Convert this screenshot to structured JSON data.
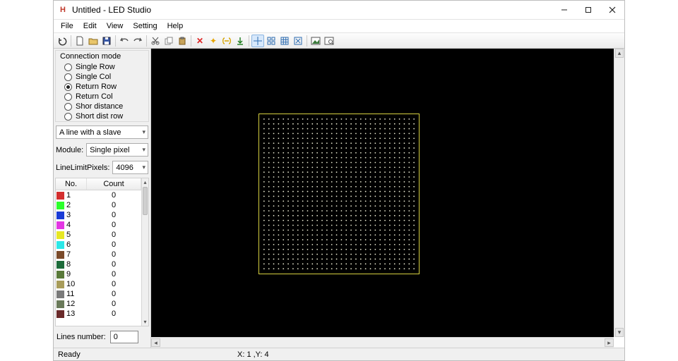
{
  "window": {
    "title": "Untitled - LED Studio"
  },
  "menu": {
    "file": "File",
    "edit": "Edit",
    "view": "View",
    "setting": "Setting",
    "help": "Help"
  },
  "connection_mode": {
    "title": "Connection mode",
    "options": [
      {
        "label": "Single Row",
        "selected": false
      },
      {
        "label": "Single Col",
        "selected": false
      },
      {
        "label": "Return Row",
        "selected": true
      },
      {
        "label": "Return Col",
        "selected": false
      },
      {
        "label": "Shor distance",
        "selected": false
      },
      {
        "label": "Short dist row",
        "selected": false
      }
    ]
  },
  "slave_combo": {
    "value": "A line with a slave"
  },
  "module": {
    "label": "Module:",
    "value": "Single pixel"
  },
  "line_limit": {
    "label": "LineLimitPixels:",
    "value": "4096"
  },
  "table": {
    "headers": {
      "no": "No.",
      "count": "Count"
    },
    "rows": [
      {
        "no": "1",
        "count": "0",
        "color": "#d32f2f"
      },
      {
        "no": "2",
        "count": "0",
        "color": "#2bff2b"
      },
      {
        "no": "3",
        "count": "0",
        "color": "#1a3bd6"
      },
      {
        "no": "4",
        "count": "0",
        "color": "#e336e3"
      },
      {
        "no": "5",
        "count": "0",
        "color": "#e7e723"
      },
      {
        "no": "6",
        "count": "0",
        "color": "#2be7e7"
      },
      {
        "no": "7",
        "count": "0",
        "color": "#7a4a2a"
      },
      {
        "no": "8",
        "count": "0",
        "color": "#1d6b3a"
      },
      {
        "no": "9",
        "count": "0",
        "color": "#5a7a3a"
      },
      {
        "no": "10",
        "count": "0",
        "color": "#a89c5a"
      },
      {
        "no": "11",
        "count": "0",
        "color": "#7a7a7a"
      },
      {
        "no": "12",
        "count": "0",
        "color": "#6a7a5a"
      },
      {
        "no": "13",
        "count": "0",
        "color": "#6a2a2a"
      }
    ]
  },
  "lines_number": {
    "label": "Lines number:",
    "value": "0"
  },
  "status": {
    "ready": "Ready",
    "coords": "X: 1 ,Y: 4"
  }
}
